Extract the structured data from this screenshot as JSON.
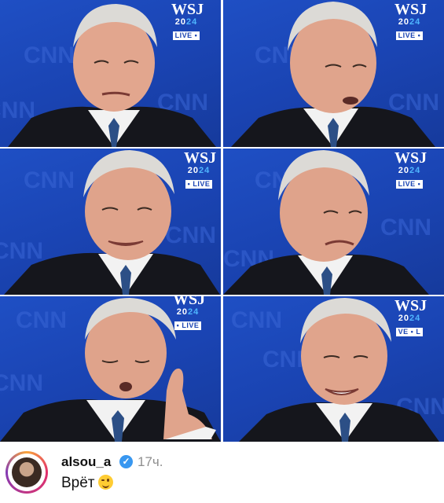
{
  "panels": [
    {
      "wsj": "WSJ",
      "year_a": "20",
      "year_b": "24",
      "live": "LIVE •",
      "bg_text": "CNN"
    },
    {
      "wsj": "WSJ",
      "year_a": "20",
      "year_b": "24",
      "live": "LIVE •",
      "bg_text": "CNN"
    },
    {
      "wsj": "WSJ",
      "year_a": "20",
      "year_b": "24",
      "live": "• LIVE",
      "bg_text": "CNN"
    },
    {
      "wsj": "WSJ",
      "year_a": "20",
      "year_b": "24",
      "live": "LIVE •",
      "bg_text": "CNN"
    },
    {
      "wsj": "WSJ",
      "year_a": "20",
      "year_b": "24",
      "live": "• LIVE",
      "bg_text": "CNN"
    },
    {
      "wsj": "WSJ",
      "year_a": "20",
      "year_b": "24",
      "live": "VE • L",
      "bg_text": "CNN"
    }
  ],
  "post": {
    "username": "alsou_a",
    "verified": true,
    "time": "17ч.",
    "comment": "Врёт",
    "emoji": "winking-face"
  },
  "colors": {
    "backdrop": "#1a44b3",
    "verified_badge": "#3897f0"
  }
}
